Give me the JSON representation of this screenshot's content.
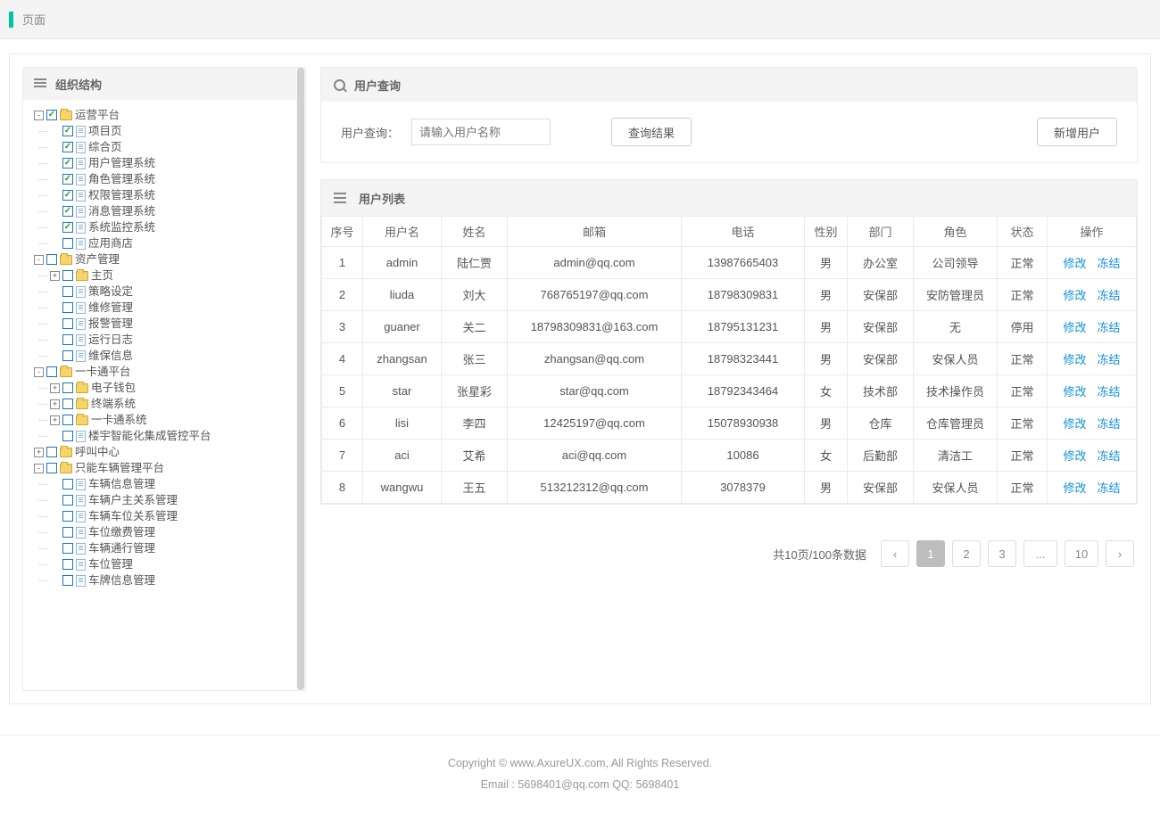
{
  "top": {
    "title": "页面"
  },
  "org_panel": {
    "title": "组织结构"
  },
  "tree": [
    {
      "type": "folder",
      "toggle": "-",
      "checked": true,
      "label": "运营平台",
      "children": [
        {
          "type": "file",
          "checked": true,
          "label": "项目页"
        },
        {
          "type": "file",
          "checked": true,
          "label": "综合页"
        },
        {
          "type": "file",
          "checked": true,
          "label": "用户管理系统"
        },
        {
          "type": "file",
          "checked": true,
          "label": "角色管理系统"
        },
        {
          "type": "file",
          "checked": true,
          "label": "权限管理系统"
        },
        {
          "type": "file",
          "checked": true,
          "label": "消息管理系统"
        },
        {
          "type": "file",
          "checked": true,
          "label": "系统监控系统"
        },
        {
          "type": "file",
          "checked": false,
          "label": "应用商店"
        }
      ]
    },
    {
      "type": "folder",
      "toggle": "-",
      "checked": false,
      "label": "资产管理",
      "children": [
        {
          "type": "folder",
          "toggle": "+",
          "checked": false,
          "label": "主页"
        },
        {
          "type": "file",
          "checked": false,
          "label": "策略设定"
        },
        {
          "type": "file",
          "checked": false,
          "label": "维修管理"
        },
        {
          "type": "file",
          "checked": false,
          "label": "报警管理"
        },
        {
          "type": "file",
          "checked": false,
          "label": "运行日志"
        },
        {
          "type": "file",
          "checked": false,
          "label": "维保信息"
        }
      ]
    },
    {
      "type": "folder",
      "toggle": "-",
      "checked": false,
      "label": "一卡通平台",
      "children": [
        {
          "type": "folder",
          "toggle": "+",
          "checked": false,
          "label": "电子钱包"
        },
        {
          "type": "folder",
          "toggle": "+",
          "checked": false,
          "label": "终端系统"
        },
        {
          "type": "folder",
          "toggle": "+",
          "checked": false,
          "label": "一卡通系统"
        },
        {
          "type": "file",
          "checked": false,
          "label": "楼宇智能化集成管控平台"
        }
      ]
    },
    {
      "type": "folder",
      "toggle": "+",
      "checked": false,
      "label": "呼叫中心"
    },
    {
      "type": "folder",
      "toggle": "-",
      "checked": false,
      "label": "只能车辆管理平台",
      "children": [
        {
          "type": "file",
          "checked": false,
          "label": "车辆信息管理"
        },
        {
          "type": "file",
          "checked": false,
          "label": "车辆户主关系管理"
        },
        {
          "type": "file",
          "checked": false,
          "label": "车辆车位关系管理"
        },
        {
          "type": "file",
          "checked": false,
          "label": "车位缴费管理"
        },
        {
          "type": "file",
          "checked": false,
          "label": "车辆通行管理"
        },
        {
          "type": "file",
          "checked": false,
          "label": "车位管理"
        },
        {
          "type": "file",
          "checked": false,
          "label": "车牌信息管理"
        }
      ]
    }
  ],
  "search": {
    "title": "用户查询",
    "label": "用户查询：",
    "placeholder": "请输入用户名称",
    "query_btn": "查询结果",
    "add_btn": "新增用户"
  },
  "list": {
    "title": "用户列表",
    "headers": [
      "序号",
      "用户名",
      "姓名",
      "邮箱",
      "电话",
      "性别",
      "部门",
      "角色",
      "状态",
      "操作"
    ],
    "action_edit": "修改",
    "action_freeze": "冻结",
    "rows": [
      [
        "1",
        "admin",
        "陆仁贾",
        "admin@qq.com",
        "13987665403",
        "男",
        "办公室",
        "公司领导",
        "正常"
      ],
      [
        "2",
        "liuda",
        "刘大",
        "768765197@qq.com",
        "18798309831",
        "男",
        "安保部",
        "安防管理员",
        "正常"
      ],
      [
        "3",
        "guaner",
        "关二",
        "18798309831@163.com",
        "18795131231",
        "男",
        "安保部",
        "无",
        "停用"
      ],
      [
        "4",
        "zhangsan",
        "张三",
        "zhangsan@qq.com",
        "18798323441",
        "男",
        "安保部",
        "安保人员",
        "正常"
      ],
      [
        "5",
        "star",
        "张星彩",
        "star@qq.com",
        "18792343464",
        "女",
        "技术部",
        "技术操作员",
        "正常"
      ],
      [
        "6",
        "lisi",
        "李四",
        "12425197@qq.com",
        "15078930938",
        "男",
        "仓库",
        "仓库管理员",
        "正常"
      ],
      [
        "7",
        "aci",
        "艾希",
        "aci@qq.com",
        "10086",
        "女",
        "后勤部",
        "清洁工",
        "正常"
      ],
      [
        "8",
        "wangwu",
        "王五",
        "513212312@qq.com",
        "3078379",
        "男",
        "安保部",
        "安保人员",
        "正常"
      ]
    ]
  },
  "pager": {
    "summary": "共10页/100条数据",
    "pages": [
      "1",
      "2",
      "3",
      "...",
      "10"
    ],
    "active": "1"
  },
  "footer": {
    "line1": "Copyright © www.AxureUX.com, All Rights Reserved.",
    "line2": "Email : 5698401@qq.com  QQ: 5698401"
  }
}
